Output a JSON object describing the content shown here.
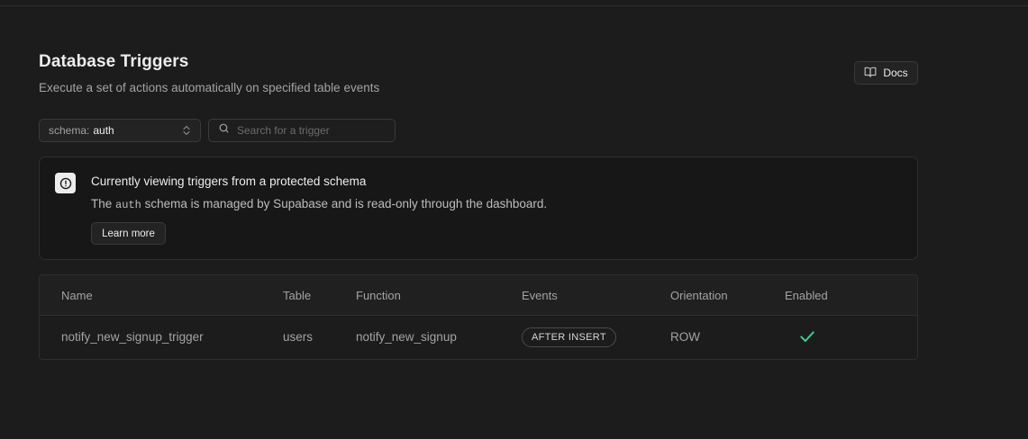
{
  "header": {
    "title": "Database Triggers",
    "subtitle": "Execute a set of actions automatically on specified table events",
    "docs_label": "Docs"
  },
  "filters": {
    "schema_label": "schema:",
    "schema_value": "auth",
    "search_placeholder": "Search for a trigger",
    "search_value": ""
  },
  "alert": {
    "title": "Currently viewing triggers from a protected schema",
    "body_prefix": "The",
    "body_code": "auth",
    "body_suffix": "schema is managed by Supabase and is read-only through the dashboard.",
    "button_label": "Learn more"
  },
  "table": {
    "columns": [
      "Name",
      "Table",
      "Function",
      "Events",
      "Orientation",
      "Enabled"
    ],
    "rows": [
      {
        "name": "notify_new_signup_trigger",
        "table": "users",
        "function": "notify_new_signup",
        "event": "AFTER INSERT",
        "orientation": "ROW",
        "enabled": true
      }
    ]
  },
  "colors": {
    "background": "#1c1c1c",
    "enabled_check": "#3ecf8e"
  },
  "icons": {
    "docs": "book-icon",
    "schema": "chevrons-up-down-icon",
    "search": "search-icon",
    "alert": "alert-circle-icon",
    "enabled": "check-icon"
  }
}
